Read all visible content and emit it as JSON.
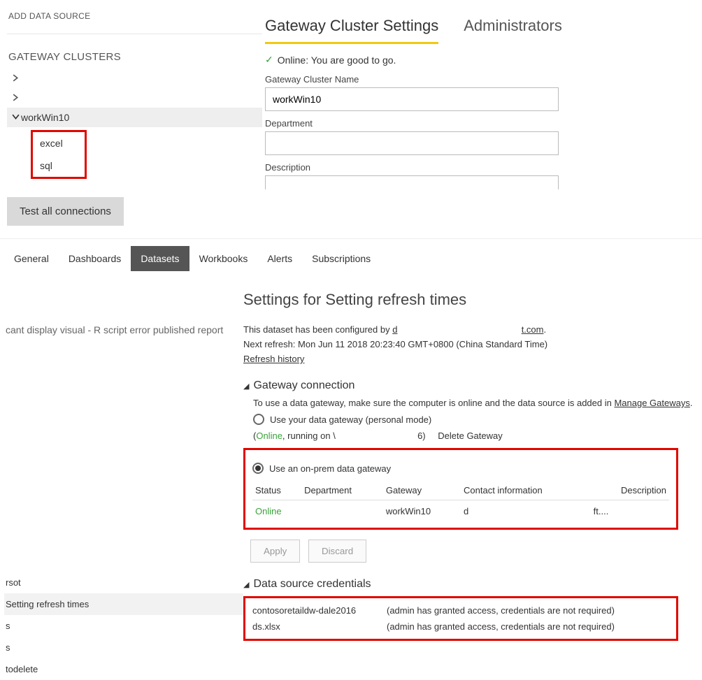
{
  "header": {
    "add_data_source": "ADD DATA SOURCE",
    "clusters_title": "GATEWAY CLUSTERS"
  },
  "tree": {
    "expanded_cluster": "workWin10",
    "data_sources": [
      "excel",
      "sql"
    ]
  },
  "buttons": {
    "test_connections": "Test all connections"
  },
  "rtabs": {
    "settings": "Gateway Cluster Settings",
    "admins": "Administrators"
  },
  "status": {
    "text": "Online: You are good to go."
  },
  "form": {
    "name_label": "Gateway Cluster Name",
    "name_value": "workWin10",
    "dept_label": "Department",
    "dept_value": "",
    "desc_label": "Description",
    "desc_value": ""
  },
  "lowtabs": {
    "general": "General",
    "dashboards": "Dashboards",
    "datasets": "Datasets",
    "workbooks": "Workbooks",
    "alerts": "Alerts",
    "subscriptions": "Subscriptions"
  },
  "lowleft": {
    "heading": "cant display visual - R script error published report",
    "rsot": "rsot",
    "selected": "Setting refresh times",
    "s1": "s",
    "s2": "s",
    "todelete": "todelete"
  },
  "settings": {
    "title": "Settings for Setting refresh times",
    "configured_prefix": "This dataset has been configured by ",
    "configured_user1": "d",
    "configured_user2": "t.com",
    "configured_suffix": ".",
    "next_refresh": "Next refresh: Mon Jun 11 2018 20:23:40 GMT+0800 (China Standard Time)",
    "refresh_history": "Refresh history"
  },
  "gw": {
    "heading": "Gateway connection",
    "blurb": "To use a data gateway, make sure the computer is online and the data source is added in ",
    "manage": "Manage Gateways",
    "opt1": "Use your data gateway (personal mode)",
    "paren_open": "(",
    "online": "Online",
    "running": ", running on \\",
    "paren_close": "6)",
    "delete": "Delete Gateway",
    "opt2": "Use an on-prem data gateway",
    "th_status": "Status",
    "th_dept": "Department",
    "th_gw": "Gateway",
    "th_contact": "Contact information",
    "th_desc": "Description",
    "row_status": "Online",
    "row_dept": "",
    "row_gw": "workWin10",
    "row_contact": "d",
    "row_desc": "ft....",
    "apply": "Apply",
    "discard": "Discard"
  },
  "creds": {
    "heading": "Data source credentials",
    "r1_name": "contosoretaildw-dale2016",
    "r1_msg": "(admin has granted access, credentials are not required)",
    "r2_name": "ds.xlsx",
    "r2_msg": "(admin has granted access, credentials are not required)"
  }
}
